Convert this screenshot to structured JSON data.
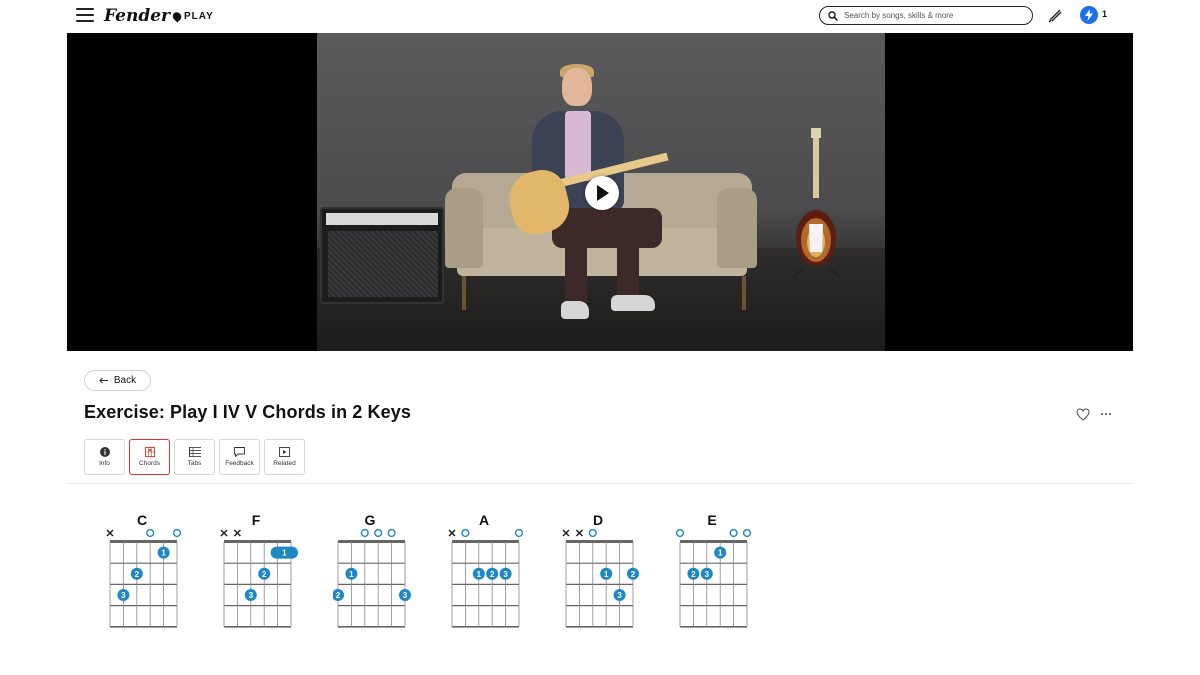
{
  "header": {
    "logo_text": "Fender",
    "logo_suffix": "PLAY",
    "search_placeholder": "Search by songs, skills & more",
    "bolt_count": "1"
  },
  "lesson": {
    "back_label": "Back",
    "title": "Exercise: Play I IV V Chords in 2 Keys"
  },
  "tabs": [
    {
      "label": "Info",
      "icon": "info-icon"
    },
    {
      "label": "Chords",
      "icon": "chord-grid-icon",
      "active": true
    },
    {
      "label": "Tabs",
      "icon": "tabs-icon"
    },
    {
      "label": "Feedback",
      "icon": "feedback-icon"
    },
    {
      "label": "Related",
      "icon": "related-video-icon"
    }
  ],
  "colors": {
    "accent_red": "#d9342b",
    "chord_blue": "#1e88c7",
    "bolt_blue": "#1b6fe8"
  },
  "chords": [
    {
      "name": "C",
      "top": [
        "x",
        "",
        "",
        "o",
        "",
        "o"
      ],
      "dots": [
        {
          "fret": 1,
          "string": 4,
          "finger": "1"
        },
        {
          "fret": 2,
          "string": 2,
          "finger": "2"
        },
        {
          "fret": 3,
          "string": 1,
          "finger": "3"
        }
      ]
    },
    {
      "name": "F",
      "top": [
        "x",
        "x",
        "",
        "",
        "",
        ""
      ],
      "barre": {
        "fret": 1,
        "from": 4,
        "to": 5,
        "finger": "1"
      },
      "dots": [
        {
          "fret": 2,
          "string": 3,
          "finger": "2"
        },
        {
          "fret": 3,
          "string": 2,
          "finger": "3"
        }
      ]
    },
    {
      "name": "G",
      "top": [
        "",
        "",
        "o",
        "o",
        "o",
        ""
      ],
      "dots": [
        {
          "fret": 2,
          "string": 1,
          "finger": "1"
        },
        {
          "fret": 3,
          "string": 0,
          "finger": "2"
        },
        {
          "fret": 3,
          "string": 5,
          "finger": "3"
        }
      ]
    },
    {
      "name": "A",
      "top": [
        "x",
        "o",
        "",
        "",
        "",
        "o"
      ],
      "dots": [
        {
          "fret": 2,
          "string": 2,
          "finger": "1"
        },
        {
          "fret": 2,
          "string": 3,
          "finger": "2"
        },
        {
          "fret": 2,
          "string": 4,
          "finger": "3"
        }
      ]
    },
    {
      "name": "D",
      "top": [
        "x",
        "x",
        "o",
        "",
        "",
        ""
      ],
      "dots": [
        {
          "fret": 2,
          "string": 3,
          "finger": "1"
        },
        {
          "fret": 2,
          "string": 5,
          "finger": "2"
        },
        {
          "fret": 3,
          "string": 4,
          "finger": "3"
        }
      ]
    },
    {
      "name": "E",
      "top": [
        "o",
        "",
        "",
        "",
        "o",
        "o"
      ],
      "dots": [
        {
          "fret": 1,
          "string": 3,
          "finger": "1"
        },
        {
          "fret": 2,
          "string": 1,
          "finger": "2"
        },
        {
          "fret": 2,
          "string": 2,
          "finger": "3"
        }
      ]
    }
  ]
}
